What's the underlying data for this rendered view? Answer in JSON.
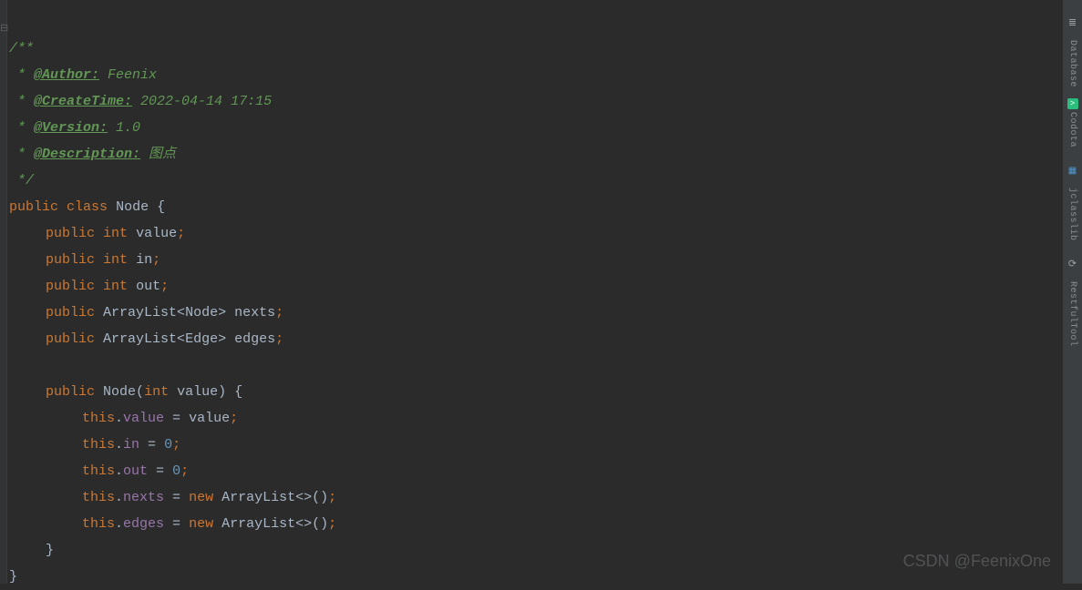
{
  "doc": {
    "open": "/**",
    "star": " * ",
    "tag_author": "@Author:",
    "author_val": " Feenix",
    "tag_create": "@CreateTime:",
    "create_val": " 2022-04-14 17:15",
    "tag_version": "@Version:",
    "version_val": " 1.0",
    "tag_desc": "@Description:",
    "desc_val": " 图点",
    "close": " */"
  },
  "kw": {
    "public": "public",
    "class": "class",
    "int": "int",
    "this": "this",
    "new": "new"
  },
  "cls": {
    "Node": "Node",
    "ArrayList": "ArrayList",
    "Edge": "Edge"
  },
  "fld": {
    "value": "value",
    "in": "in",
    "out": "out",
    "nexts": "nexts",
    "edges": "edges"
  },
  "num": {
    "zero": "0"
  },
  "sym": {
    "lbrace": "{",
    "rbrace": "}",
    "lt": "<",
    "gt": ">",
    "lparen": "(",
    "rparen": ")",
    "semi": ";",
    "dot": ".",
    "eq": " = ",
    "diamond": "<>()"
  },
  "toolbar": {
    "database": "Database",
    "codota": "Codota",
    "jclasslib": "jclasslib",
    "restful": "RestfulTool"
  },
  "watermark": "CSDN @FeenixOne",
  "gutter_mark": "⊟"
}
